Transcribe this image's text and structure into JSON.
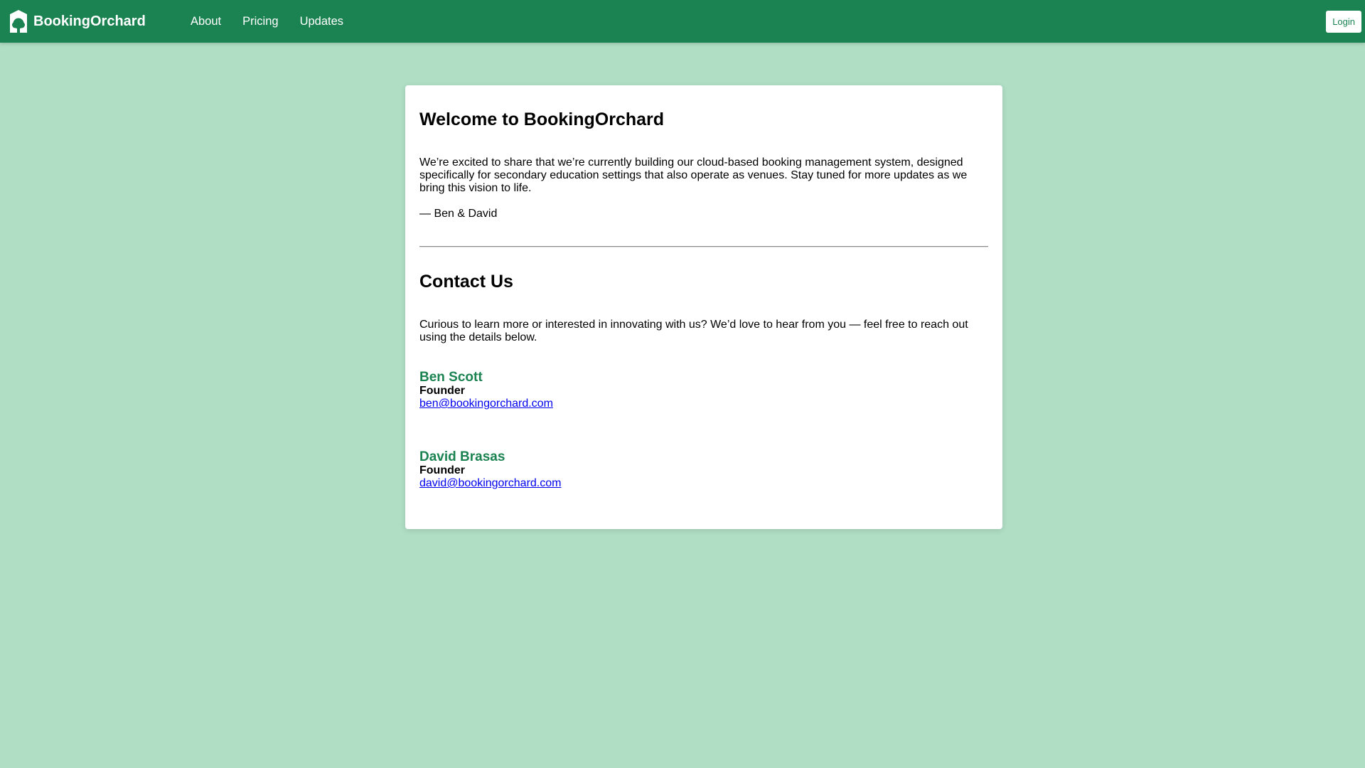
{
  "nav": {
    "brand": "BookingOrchard",
    "links": [
      "About",
      "Pricing",
      "Updates"
    ],
    "login_label": "Login"
  },
  "welcome": {
    "title": "Welcome to BookingOrchard",
    "body": "We’re excited to share that we’re currently building our cloud-based booking management system, designed specifically for secondary education settings that also operate as venues. Stay tuned for more updates as we bring this vision to life.",
    "signature": "— Ben & David"
  },
  "contact": {
    "title": "Contact Us",
    "intro": "Curious to learn more or interested in innovating with us? We’d love to hear from you — feel free to reach out using the details below.",
    "people": [
      {
        "name": "Ben Scott",
        "role": "Founder",
        "email": "ben@bookingorchard.com"
      },
      {
        "name": "David Brasas",
        "role": "Founder",
        "email": "david@bookingorchard.com"
      }
    ]
  },
  "colors": {
    "navbar": "#1b8251",
    "background": "#afdec4",
    "accent": "#1b8251",
    "link": "#0000ee"
  },
  "icons": {
    "brand": "tree-icon"
  }
}
